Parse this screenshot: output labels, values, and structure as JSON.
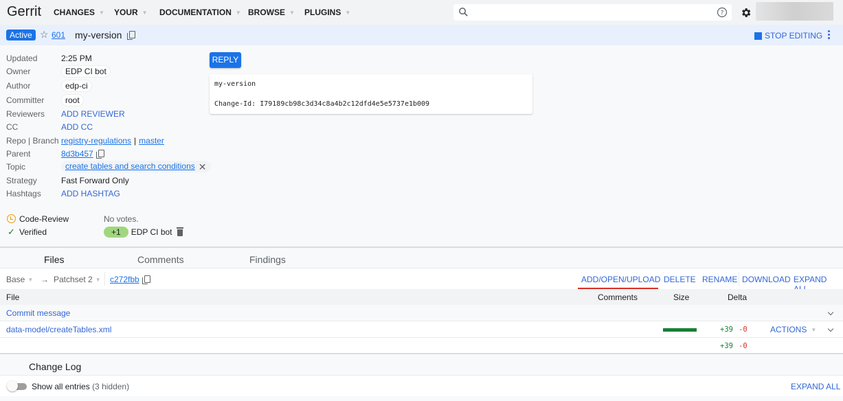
{
  "header": {
    "logo": "Gerrit",
    "nav": [
      {
        "label": "CHANGES"
      },
      {
        "label": "YOUR"
      },
      {
        "label": "DOCUMENTATION"
      },
      {
        "label": "BROWSE"
      },
      {
        "label": "PLUGINS"
      }
    ],
    "search": {
      "placeholder": "",
      "value": ""
    },
    "icons": {
      "search": "search-icon",
      "help": "help-icon",
      "settings": "gear-icon"
    }
  },
  "change": {
    "status": "Active",
    "number": "601",
    "subject": "my-version",
    "stop_editing": "STOP EDITING"
  },
  "metadata": {
    "rows": [
      {
        "label": "Updated",
        "value": "2:25 PM"
      },
      {
        "label": "Owner",
        "value": "EDP CI bot"
      },
      {
        "label": "Author",
        "value": "edp-ci"
      },
      {
        "label": "Committer",
        "value": "root"
      },
      {
        "label": "Reviewers",
        "value": "ADD REVIEWER"
      },
      {
        "label": "CC",
        "value": "ADD CC"
      },
      {
        "label": "Repo | Branch",
        "repo": "registry-regulations",
        "sep": "|",
        "branch": "master"
      },
      {
        "label": "Parent",
        "value": "8d3b457"
      },
      {
        "label": "Topic",
        "value": "create tables and search conditions"
      },
      {
        "label": "Strategy",
        "value": "Fast Forward Only"
      },
      {
        "label": "Hashtags",
        "value": "ADD HASHTAG"
      }
    ]
  },
  "labels": [
    {
      "name": "Code-Review",
      "value": "No votes.",
      "status": "pending"
    },
    {
      "name": "Verified",
      "vote": "+1",
      "voter": "EDP CI bot",
      "status": "approved"
    }
  ],
  "reply_button": "REPLY",
  "commit_message": {
    "subject": "my-version",
    "change_id": "Change-Id: I79189cb98c3d34c8a4b2c12dfd4e5e5737e1b009"
  },
  "tabs": [
    {
      "label": "Files",
      "active": true
    },
    {
      "label": "Comments",
      "active": false
    },
    {
      "label": "Findings",
      "active": false
    }
  ],
  "file_toolbar": {
    "base": "Base",
    "arrow": "→",
    "patchset": "Patchset 2",
    "commit": "c272fbb",
    "actions": [
      "ADD/OPEN/UPLOAD",
      "DELETE",
      "RENAME",
      "DOWNLOAD",
      "EXPAND ALL"
    ]
  },
  "file_table": {
    "headers": {
      "file": "File",
      "comments": "Comments",
      "size": "Size",
      "delta": "Delta"
    },
    "rows": [
      {
        "name": "Commit message"
      },
      {
        "name": "data-model/createTables.xml",
        "added": "+39",
        "removed": "-0",
        "size_fraction": 1.0,
        "actions": "ACTIONS"
      }
    ],
    "totals": {
      "added": "+39",
      "removed": "-0"
    }
  },
  "change_log": {
    "title": "Change Log",
    "toggle_label": "Show all entries",
    "hidden": "(3 hidden)",
    "toggle_on": false,
    "expand_all": "EXPAND ALL"
  },
  "colors": {
    "accent": "#1a73e8",
    "link": "#3367d6",
    "added": "#188038",
    "removed": "#d93025",
    "vote_approved": "#9fd77e"
  }
}
